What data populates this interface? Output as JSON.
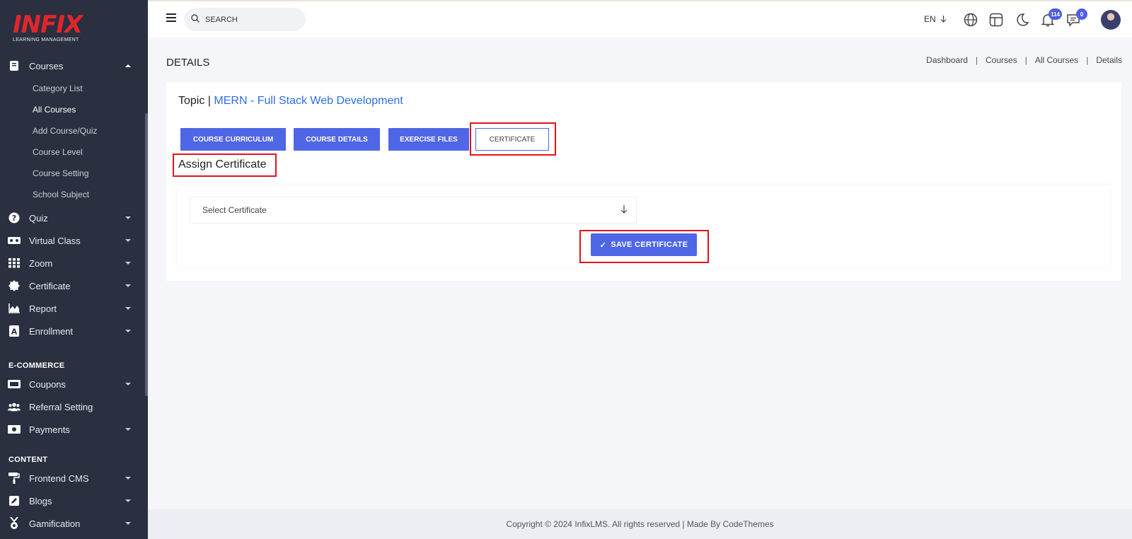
{
  "brand": {
    "logo_text": "INFIX",
    "tagline": "LEARNING MANAGEMENT"
  },
  "sidebar": {
    "courses": {
      "label": "Courses",
      "icon": "book-icon"
    },
    "sub_items": [
      "Category List",
      "All Courses",
      "Add Course/Quiz",
      "Course Level",
      "Course Setting",
      "School Subject"
    ],
    "active_sub": "All Courses",
    "items": [
      {
        "label": "Quiz",
        "icon": "question-circle-icon"
      },
      {
        "label": "Virtual Class",
        "icon": "vr-headset-icon"
      },
      {
        "label": "Zoom",
        "icon": "grid-icon"
      },
      {
        "label": "Certificate",
        "icon": "certificate-badge-icon"
      },
      {
        "label": "Report",
        "icon": "area-chart-icon"
      },
      {
        "label": "Enrollment",
        "icon": "enrollment-icon"
      }
    ],
    "ecommerce_title": "E-COMMERCE",
    "ecommerce_items": [
      {
        "label": "Coupons",
        "icon": "ticket-icon"
      },
      {
        "label": "Referral Setting",
        "icon": "users-icon"
      },
      {
        "label": "Payments",
        "icon": "money-bill-icon"
      }
    ],
    "content_title": "CONTENT",
    "content_items": [
      {
        "label": "Frontend CMS",
        "icon": "paint-roller-icon"
      },
      {
        "label": "Blogs",
        "icon": "edit-icon"
      },
      {
        "label": "Gamification",
        "icon": "medal-icon"
      }
    ]
  },
  "topbar": {
    "search_placeholder": "SEARCH",
    "language": "EN",
    "notifications_count": "114",
    "messages_count": "0"
  },
  "page": {
    "title": "DETAILS",
    "breadcrumb": [
      "Dashboard",
      "Courses",
      "All Courses",
      "Details"
    ]
  },
  "card": {
    "topic_label": "Topic |",
    "course_name": "MERN - Full Stack Web Development",
    "tabs": [
      "COURSE CURRICULUM",
      "COURSE DETAILS",
      "EXERCISE FILES",
      "CERTIFICATE"
    ],
    "active_tab": "CERTIFICATE",
    "section_title": "Assign Certificate",
    "select_placeholder": "Select Certificate",
    "save_label": "SAVE CERTIFICATE"
  },
  "footer": {
    "text": "Copyright © 2024 InfixLMS. All rights reserved | Made By CodeThemes"
  },
  "colors": {
    "accent": "#4f66e6",
    "sidebar_bg": "#2b3040",
    "link": "#2d6ee6",
    "highlight": "#e5121b",
    "brand_red": "#e0252b"
  }
}
